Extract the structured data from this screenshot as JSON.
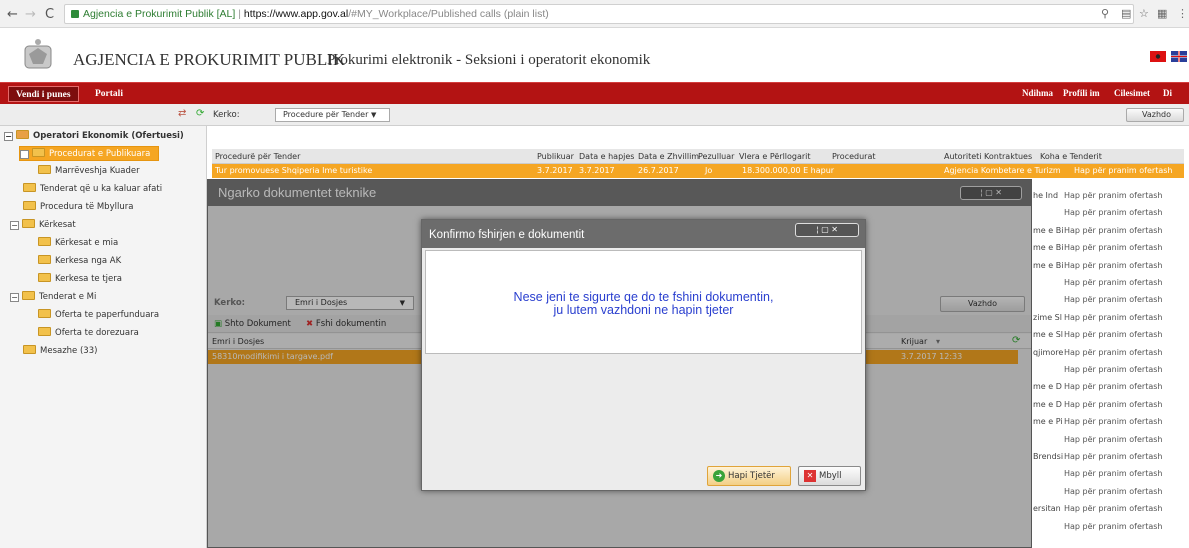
{
  "browser": {
    "site_name": "Agjencia e Prokurimit Publik [AL]",
    "separator": "|",
    "url_scheme": "https://",
    "url_domain": "www.app.gov.al",
    "url_path": "/#MY_Workplace/Published calls (plain list)"
  },
  "header": {
    "agency": "AGJENCIA E PROKURIMIT PUBLIK",
    "subtitle": "Prokurimi elektronik - Seksioni i operatorit ekonomik"
  },
  "menu": {
    "tabs": [
      "Vendi i punes",
      "Portali"
    ],
    "right_links": [
      "Ndihma",
      "Profili im",
      "Cilesimet",
      "Di"
    ]
  },
  "subbar": {
    "search_label": "Kerko:",
    "search_value": "Procedure për Tender",
    "go_label": "Vazhdo"
  },
  "sidebar": {
    "root": "Operatori Ekonomik (Ofertuesi)",
    "items": [
      {
        "label": "Procedurat e Publikuara"
      },
      {
        "label": "Marrëveshja Kuader"
      },
      {
        "label": "Tenderat që u ka kaluar afati"
      },
      {
        "label": "Procedura të Mbyllura"
      },
      {
        "label": "Kërkesat"
      },
      {
        "label": "Kërkesat e mia"
      },
      {
        "label": "Kerkesa nga AK"
      },
      {
        "label": "Kerkesa te tjera"
      },
      {
        "label": "Tenderat e Mi"
      },
      {
        "label": "Oferta te paperfunduara"
      },
      {
        "label": "Oferta te dorezuara"
      },
      {
        "label": "Mesazhe (33)"
      }
    ]
  },
  "grid": {
    "headers": [
      "Procedurë për Tender",
      "Publikuar",
      "Data e hapjes",
      "Data e Zhvillim",
      "Pezulluar",
      "Vlera e Përllogarit",
      "Procedurat",
      "Autoriteti Kontraktues",
      "Koha e Tenderit"
    ],
    "selected_row": [
      "Tur promovuese Shqiperia Ime turistike",
      "3.7.2017",
      "3.7.2017",
      "26.7.2017",
      "Jo",
      "18.300.000,00 E hapur",
      "Agjencia Kombetare e Turizm",
      "Hap për pranim ofertash"
    ],
    "koha_rows": [
      {
        "p": "he Ind",
        "s": "Hap për pranim ofertash"
      },
      {
        "p": "",
        "s": "Hap për pranim ofertash"
      },
      {
        "p": "me e Bi",
        "s": "Hap për pranim ofertash"
      },
      {
        "p": "me e Bi",
        "s": "Hap për pranim ofertash"
      },
      {
        "p": "me e Bi",
        "s": "Hap për pranim ofertash"
      },
      {
        "p": "",
        "s": "Hap për pranim ofertash"
      },
      {
        "p": "",
        "s": "Hap për pranim ofertash"
      },
      {
        "p": "zime Sl",
        "s": "Hap për pranim ofertash"
      },
      {
        "p": "me e Sl",
        "s": "Hap për pranim ofertash"
      },
      {
        "p": "qjimore",
        "s": "Hap për pranim ofertash"
      },
      {
        "p": "",
        "s": "Hap për pranim ofertash"
      },
      {
        "p": "me e D",
        "s": "Hap për pranim ofertash"
      },
      {
        "p": "me e D",
        "s": "Hap për pranim ofertash"
      },
      {
        "p": "me e Pi",
        "s": "Hap për pranim ofertash"
      },
      {
        "p": "",
        "s": "Hap për pranim ofertash"
      },
      {
        "p": "Brendsi",
        "s": "Hap për pranim ofertash"
      },
      {
        "p": "",
        "s": "Hap për pranim ofertash"
      },
      {
        "p": "",
        "s": "Hap për pranim ofertash"
      },
      {
        "p": "ersitan",
        "s": "Hap për pranim ofertash"
      },
      {
        "p": "",
        "s": "Hap për pranim ofertash"
      }
    ]
  },
  "upload_window": {
    "title": "Ngarko dokumentet teknike",
    "search_label": "Kerko:",
    "search_value": "Emri i Dosjes",
    "go_label": "Vazhdo",
    "add_doc": "Shto Dokument",
    "del_doc": "Fshi dokumentin",
    "col_name": "Emri i Dosjes",
    "col_created": "Krijuar",
    "file_name": "58310modifikimi i targave.pdf",
    "file_date": "3.7.2017 12:33"
  },
  "dialog": {
    "title": "Konfirmo fshirjen e dokumentit",
    "line1": "Nese jeni te sigurte qe do te fshini dokumentin,",
    "line2": "ju lutem vazhdoni ne hapin tjeter",
    "next_label": "Hapi Tjetër",
    "close_label": "Mbyll"
  },
  "colors": {
    "menu": "#b31313",
    "selected": "#f5a623",
    "message": "#2a3fcf"
  }
}
